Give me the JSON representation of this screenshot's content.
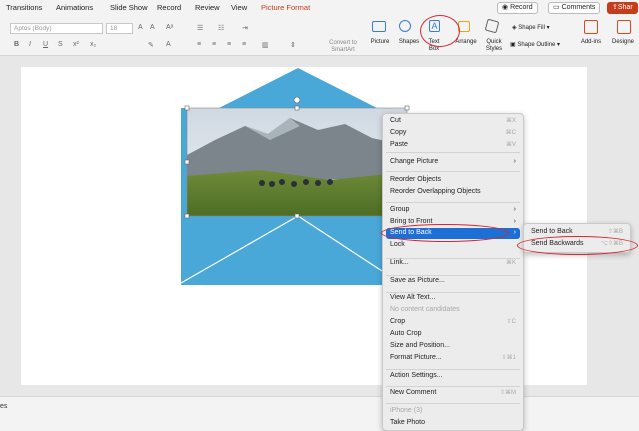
{
  "tabs": [
    "Transitions",
    "Animations",
    "Slide Show",
    "Record",
    "Review",
    "View",
    "Picture Format"
  ],
  "top_buttons": {
    "record": "Record",
    "comments": "Comments",
    "share": "Shar"
  },
  "ribbon": {
    "font_name": "Aptos (Body)",
    "font_size": "18",
    "convert_smartart": [
      "Convert to",
      "SmartArt"
    ],
    "picture": "Picture",
    "shapes": "Shapes",
    "text_box": [
      "Text",
      "Box"
    ],
    "arrange": "Arrange",
    "quick_styles": [
      "Quick",
      "Styles"
    ],
    "shape_fill": "Shape Fill",
    "shape_outline": "Shape Outline",
    "addins": "Add-ins",
    "designer": "Designe"
  },
  "status": {
    "left": "es"
  },
  "context_menu": {
    "items": [
      {
        "label": "Cut",
        "shortcut": "⌘X"
      },
      {
        "label": "Copy",
        "shortcut": "⌘C"
      },
      {
        "label": "Paste",
        "shortcut": "⌘V"
      },
      {
        "label": "Change Picture",
        "arrow": "›"
      },
      {
        "label": "Reorder Objects"
      },
      {
        "label": "Reorder Overlapping Objects"
      },
      {
        "label": "Group",
        "arrow": "›"
      },
      {
        "label": "Bring to Front",
        "arrow": "›"
      },
      {
        "label": "Send to Back",
        "arrow": "›"
      },
      {
        "label": "Lock"
      },
      {
        "label": "Link...",
        "shortcut": "⌘K"
      },
      {
        "label": "Save as Picture..."
      },
      {
        "label": "View Alt Text..."
      },
      {
        "label": "No content candidates",
        "disabled": true
      },
      {
        "label": "Crop",
        "shortcut": "⇧C"
      },
      {
        "label": "Auto Crop"
      },
      {
        "label": "Size and Position..."
      },
      {
        "label": "Format Picture...",
        "shortcut": "⇧⌘1"
      },
      {
        "label": "Action Settings..."
      },
      {
        "label": "New Comment",
        "shortcut": "⇧⌘M"
      },
      {
        "label": "iPhone (3)",
        "disabled": true
      },
      {
        "label": "Take Photo"
      }
    ]
  },
  "submenu": {
    "items": [
      {
        "label": "Send to Back",
        "shortcut": "⇧⌘B"
      },
      {
        "label": "Send Backwards",
        "shortcut": "⌥⇧⌘B"
      }
    ]
  },
  "colors": {
    "accent": "#c43e1c",
    "envelope": "#4aa8d9",
    "highlight": "#1d6fd6",
    "annotation": "#d9252e"
  }
}
